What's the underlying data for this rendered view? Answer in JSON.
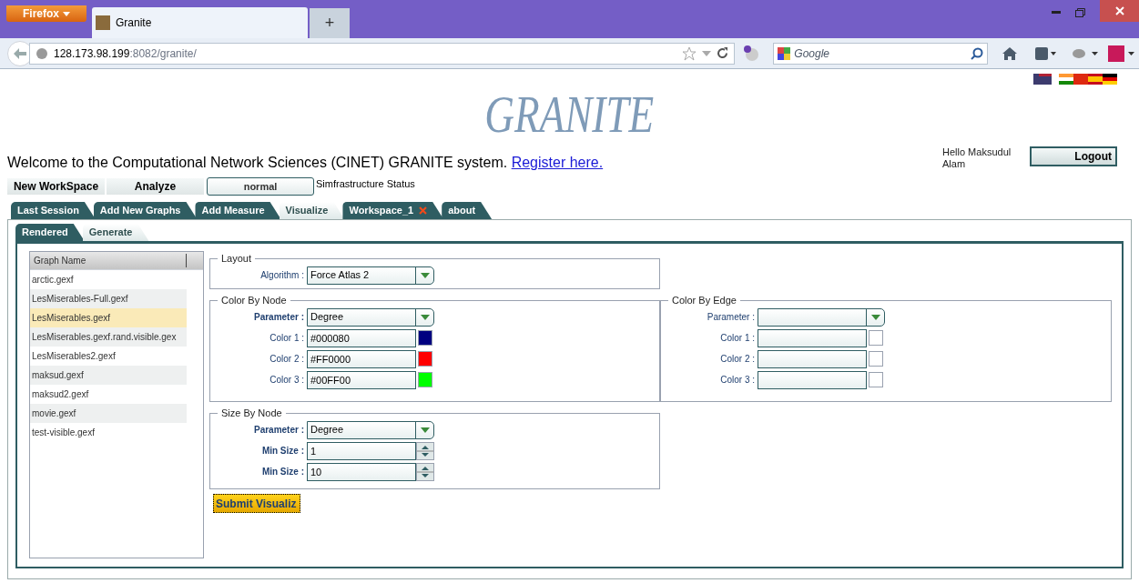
{
  "browser": {
    "menu_button": "Firefox",
    "tab_title": "Granite",
    "new_tab": "+",
    "url_host": "128.173.98.199",
    "url_rest": ":8082/granite/",
    "search_placeholder": "Google"
  },
  "header": {
    "logo": "GRANITE",
    "welcome": "Welcome to the Computational Network Sciences (CINET) GRANITE system.",
    "register_link": "Register here.",
    "greeting": "Hello Maksudul Alam",
    "logout": "Logout"
  },
  "toolbar": {
    "buttons": [
      "New WorkSpace",
      "Analyze"
    ],
    "status_value": "normal",
    "status_label": "Simfrastructure Status"
  },
  "tabs": [
    {
      "label": "Last Session",
      "selected": false,
      "closable": false
    },
    {
      "label": "Add New Graphs",
      "selected": false,
      "closable": false
    },
    {
      "label": "Add Measure",
      "selected": false,
      "closable": false
    },
    {
      "label": "Visualize",
      "selected": true,
      "closable": false
    },
    {
      "label": "Workspace_1",
      "selected": false,
      "closable": true
    },
    {
      "label": "about",
      "selected": false,
      "closable": false
    }
  ],
  "subtabs": [
    {
      "label": "Rendered",
      "selected": false
    },
    {
      "label": "Generate",
      "selected": true
    }
  ],
  "graph_list": {
    "header": "Graph Name",
    "items": [
      {
        "name": "arctic.gexf",
        "selected": false
      },
      {
        "name": "LesMiserables-Full.gexf",
        "selected": false
      },
      {
        "name": "LesMiserables.gexf",
        "selected": true
      },
      {
        "name": "LesMiserables.gexf.rand.visible.gex",
        "selected": false
      },
      {
        "name": "LesMiserables2.gexf",
        "selected": false
      },
      {
        "name": "maksud.gexf",
        "selected": false
      },
      {
        "name": "maksud2.gexf",
        "selected": false
      },
      {
        "name": "movie.gexf",
        "selected": false
      },
      {
        "name": "test-visible.gexf",
        "selected": false
      }
    ]
  },
  "layout": {
    "title": "Layout",
    "fields": [
      {
        "kind": "select",
        "label": "Algorithm :",
        "value": "Force Atlas 2"
      }
    ]
  },
  "color_by_node": {
    "title": "Color By Node",
    "fields": [
      {
        "kind": "select",
        "label": "Parameter :",
        "value": "Degree",
        "bold": true
      },
      {
        "kind": "color",
        "label": "Color 1 :",
        "value": "#000080",
        "color": "#000080"
      },
      {
        "kind": "color",
        "label": "Color 2 :",
        "value": "#FF0000",
        "color": "#ff0000"
      },
      {
        "kind": "color",
        "label": "Color 3 :",
        "value": "#00FF00",
        "color": "#00ff00"
      }
    ]
  },
  "color_by_edge": {
    "title": "Color By Edge",
    "fields": [
      {
        "kind": "select",
        "label": "Parameter :"
      },
      {
        "kind": "color",
        "label": "Color 1 :"
      },
      {
        "kind": "color",
        "label": "Color 2 :"
      },
      {
        "kind": "color",
        "label": "Color 3 :"
      }
    ]
  },
  "size_by_node": {
    "title": "Size By Node",
    "fields": [
      {
        "kind": "select",
        "label": "Parameter :",
        "value": "Degree",
        "bold": true
      },
      {
        "kind": "spinner",
        "label": "Min Size :",
        "value": "1",
        "bold": true
      },
      {
        "kind": "spinner",
        "label": "Min Size :",
        "value": "10",
        "bold": true
      }
    ]
  },
  "submit": "Submit Visualiz"
}
